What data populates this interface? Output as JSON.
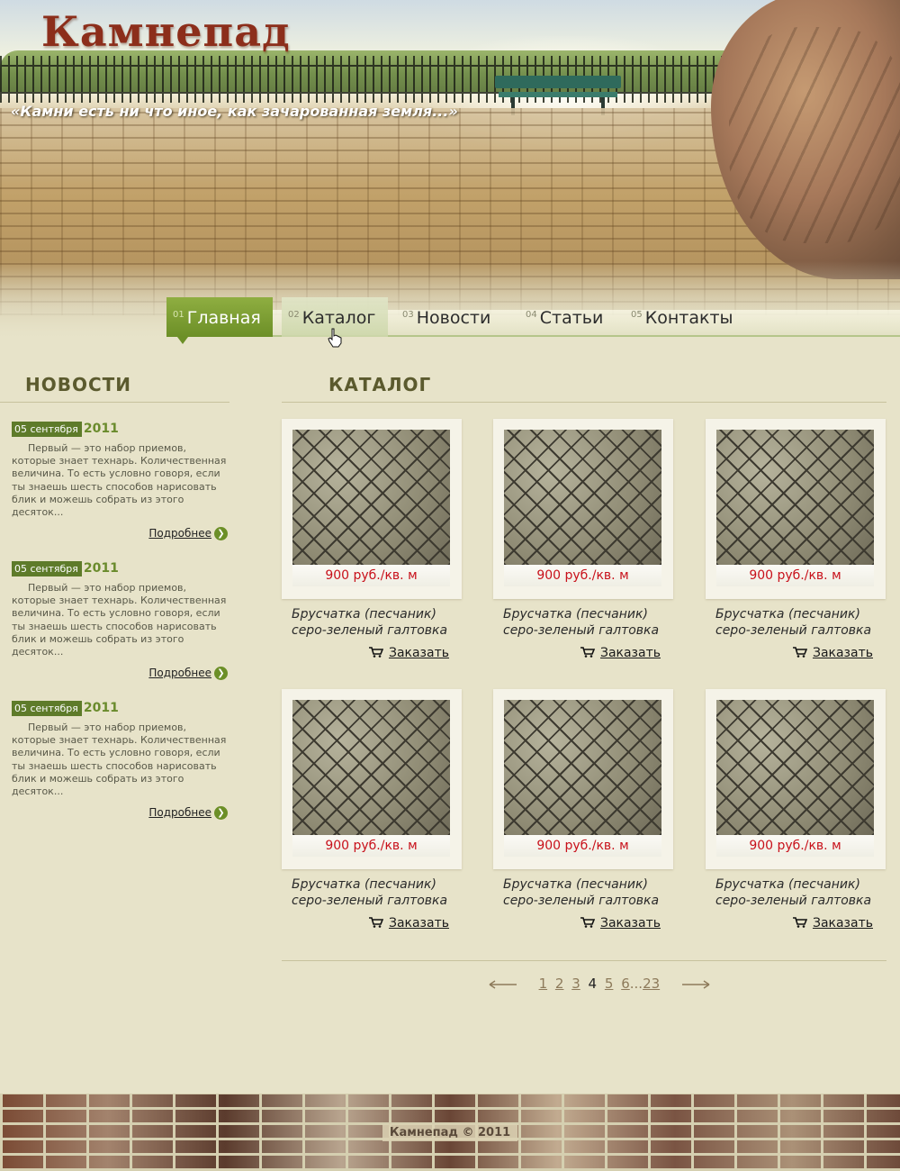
{
  "header": {
    "logo": "Камнепад",
    "slogan": "«Камни есть ни что иное, как зачарованная земля...»"
  },
  "nav": {
    "items": [
      {
        "num": "01",
        "label": "Главная",
        "active": true
      },
      {
        "num": "02",
        "label": "Каталог",
        "active": false
      },
      {
        "num": "03",
        "label": "Новости",
        "active": false
      },
      {
        "num": "04",
        "label": "Статьи",
        "active": false
      },
      {
        "num": "05",
        "label": "Контакты",
        "active": false
      }
    ]
  },
  "sidebar": {
    "title": "НОВОСТИ",
    "news": [
      {
        "date": "05 сентября",
        "year": "2011",
        "text": "Первый — это набор приемов, которые знает технарь. Количественная величина. То есть условно говоря, если ты знаешь шесть способов нарисовать блик и можешь собрать из этого десяток...",
        "more": "Подробнее"
      },
      {
        "date": "05 сентября",
        "year": "2011",
        "text": "Первый — это набор приемов, которые знает технарь. Количественная величина. То есть условно говоря, если ты знаешь шесть способов нарисовать блик и можешь собрать из этого десяток...",
        "more": "Подробнее"
      },
      {
        "date": "05 сентября",
        "year": "2011",
        "text": "Первый — это набор приемов, которые знает технарь. Количественная величина. То есть условно говоря, если ты знаешь шесть способов нарисовать блик и можешь собрать из этого десяток...",
        "more": "Подробнее"
      }
    ]
  },
  "catalog": {
    "title": "КАТАЛОГ",
    "items": [
      {
        "price": "900 руб./кв. м",
        "name_line1": "Брусчатка (песчаник)",
        "name_line2": "серо-зеленый галтовка",
        "order": "Заказать"
      },
      {
        "price": "900 руб./кв. м",
        "name_line1": "Брусчатка (песчаник)",
        "name_line2": "серо-зеленый галтовка",
        "order": "Заказать"
      },
      {
        "price": "900 руб./кв. м",
        "name_line1": "Брусчатка (песчаник)",
        "name_line2": "серо-зеленый галтовка",
        "order": "Заказать"
      },
      {
        "price": "900 руб./кв. м",
        "name_line1": "Брусчатка (песчаник)",
        "name_line2": "серо-зеленый галтовка",
        "order": "Заказать"
      },
      {
        "price": "900 руб./кв. м",
        "name_line1": "Брусчатка (песчаник)",
        "name_line2": "серо-зеленый галтовка",
        "order": "Заказать"
      },
      {
        "price": "900 руб./кв. м",
        "name_line1": "Брусчатка (песчаник)",
        "name_line2": "серо-зеленый галтовка",
        "order": "Заказать"
      }
    ]
  },
  "pagination": {
    "pages": [
      "1",
      "2",
      "3",
      "4",
      "5",
      "6"
    ],
    "current": "4",
    "ellipsis": "...",
    "last": "23"
  },
  "footer": {
    "copyright": "Камнепад © 2011"
  },
  "colors": {
    "accent_green": "#6c8f27",
    "price_red": "#c8111b",
    "logo_red": "#8c2e1b",
    "background": "#e7e3c9"
  }
}
